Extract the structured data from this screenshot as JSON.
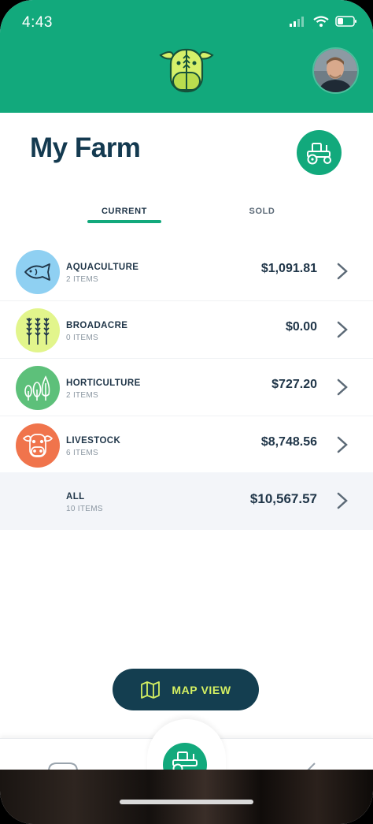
{
  "status_bar": {
    "time": "4:43"
  },
  "header": {
    "logo_icon": "cow-wheat-logo-icon",
    "avatar_icon": "user-avatar"
  },
  "page": {
    "title": "My Farm",
    "action_icon": "tractor-icon"
  },
  "tabs": [
    {
      "label": "CURRENT",
      "active": true
    },
    {
      "label": "SOLD",
      "active": false
    }
  ],
  "categories": [
    {
      "name": "AQUACULTURE",
      "count": "2 ITEMS",
      "value": "$1,091.81",
      "icon": "fish-icon",
      "color": "#8fd0f2"
    },
    {
      "name": "BROADACRE",
      "count": "0 ITEMS",
      "value": "$0.00",
      "icon": "wheat-icon",
      "color": "#e2f58c"
    },
    {
      "name": "HORTICULTURE",
      "count": "2 ITEMS",
      "value": "$727.20",
      "icon": "trees-icon",
      "color": "#5dc07a"
    },
    {
      "name": "LIVESTOCK",
      "count": "6 ITEMS",
      "value": "$8,748.56",
      "icon": "cow-icon",
      "color": "#f0744c"
    }
  ],
  "total": {
    "name": "ALL",
    "count": "10 ITEMS",
    "value": "$10,567.57"
  },
  "map_button": {
    "label": "MAP VIEW",
    "icon": "map-icon"
  },
  "colors": {
    "brand_green": "#12a97c",
    "navy": "#143e50",
    "lime": "#d4ef62"
  }
}
